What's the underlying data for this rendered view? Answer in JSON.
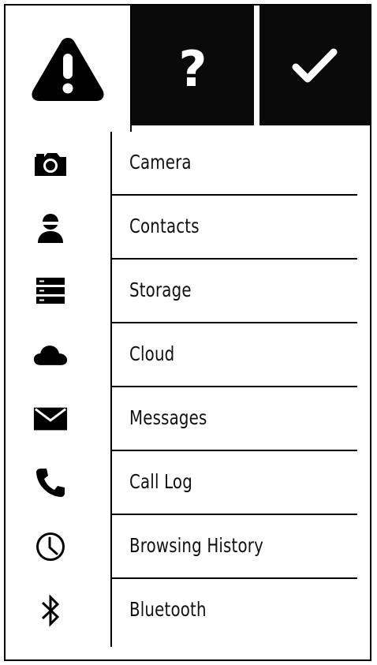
{
  "tabs": [
    {
      "name": "warning",
      "icon": "warning-icon",
      "active": true
    },
    {
      "name": "help",
      "icon": "question-icon",
      "glyph": "?",
      "active": false
    },
    {
      "name": "done",
      "icon": "checkmark-icon",
      "active": false
    }
  ],
  "items": [
    {
      "label": "Camera",
      "icon": "camera-icon"
    },
    {
      "label": "Contacts",
      "icon": "contact-icon"
    },
    {
      "label": "Storage",
      "icon": "storage-icon"
    },
    {
      "label": "Cloud",
      "icon": "cloud-icon"
    },
    {
      "label": "Messages",
      "icon": "envelope-icon"
    },
    {
      "label": "Call Log",
      "icon": "phone-icon"
    },
    {
      "label": "Browsing History",
      "icon": "clock-icon"
    },
    {
      "label": "Bluetooth",
      "icon": "bluetooth-icon"
    }
  ],
  "colors": {
    "foreground": "#000000",
    "tab_inactive_bg": "#0a0a0a",
    "background": "#ffffff"
  }
}
